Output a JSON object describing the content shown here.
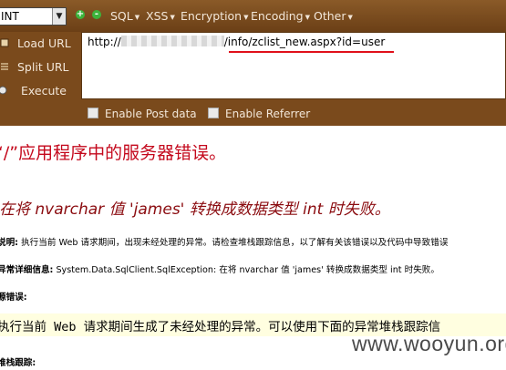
{
  "toolbar": {
    "select_value": "INT",
    "plus_icon": "+",
    "minus_icon": "-",
    "menus": [
      {
        "label": "SQL"
      },
      {
        "label": "XSS"
      },
      {
        "label": "Encryption"
      },
      {
        "label": "Encoding"
      },
      {
        "label": "Other"
      }
    ],
    "load_url": "Load URL",
    "split_url": "Split URL",
    "execute": "Execute",
    "url_prefix": "http://",
    "url_suffix": "/info/zclist_new.aspx?id=user",
    "enable_post": "Enable Post data",
    "enable_referrer": "Enable Referrer"
  },
  "page": {
    "title": "“/”应用程序中的服务器错误。",
    "error_message": "在将 nvarchar 值 'james' 转换成数据类型 int 时失败。",
    "desc_label": "说明:",
    "desc_text": "执行当前 Web 请求期间，出现未经处理的异常。请检查堆栈跟踪信息，以了解有关该错误以及代码中导致错误",
    "exception_label": "异常详细信息:",
    "exception_text": "System.Data.SqlClient.SqlException: 在将 nvarchar 值 'james' 转换成数据类型 int 时失败。",
    "source_label": "源错误:",
    "source_text": "执行当前 Web 请求期间生成了未经处理的异常。可以使用下面的异常堆栈跟踪信",
    "stack_label": "堆栈跟踪:",
    "watermark": "www.wooyun.org"
  },
  "colors": {
    "toolbar_bg": "#7a4a1c",
    "error_title": "#c4081c",
    "error_message": "#8b0c10",
    "highlight_bg": "#fffee0",
    "url_underline": "#e0101a"
  }
}
